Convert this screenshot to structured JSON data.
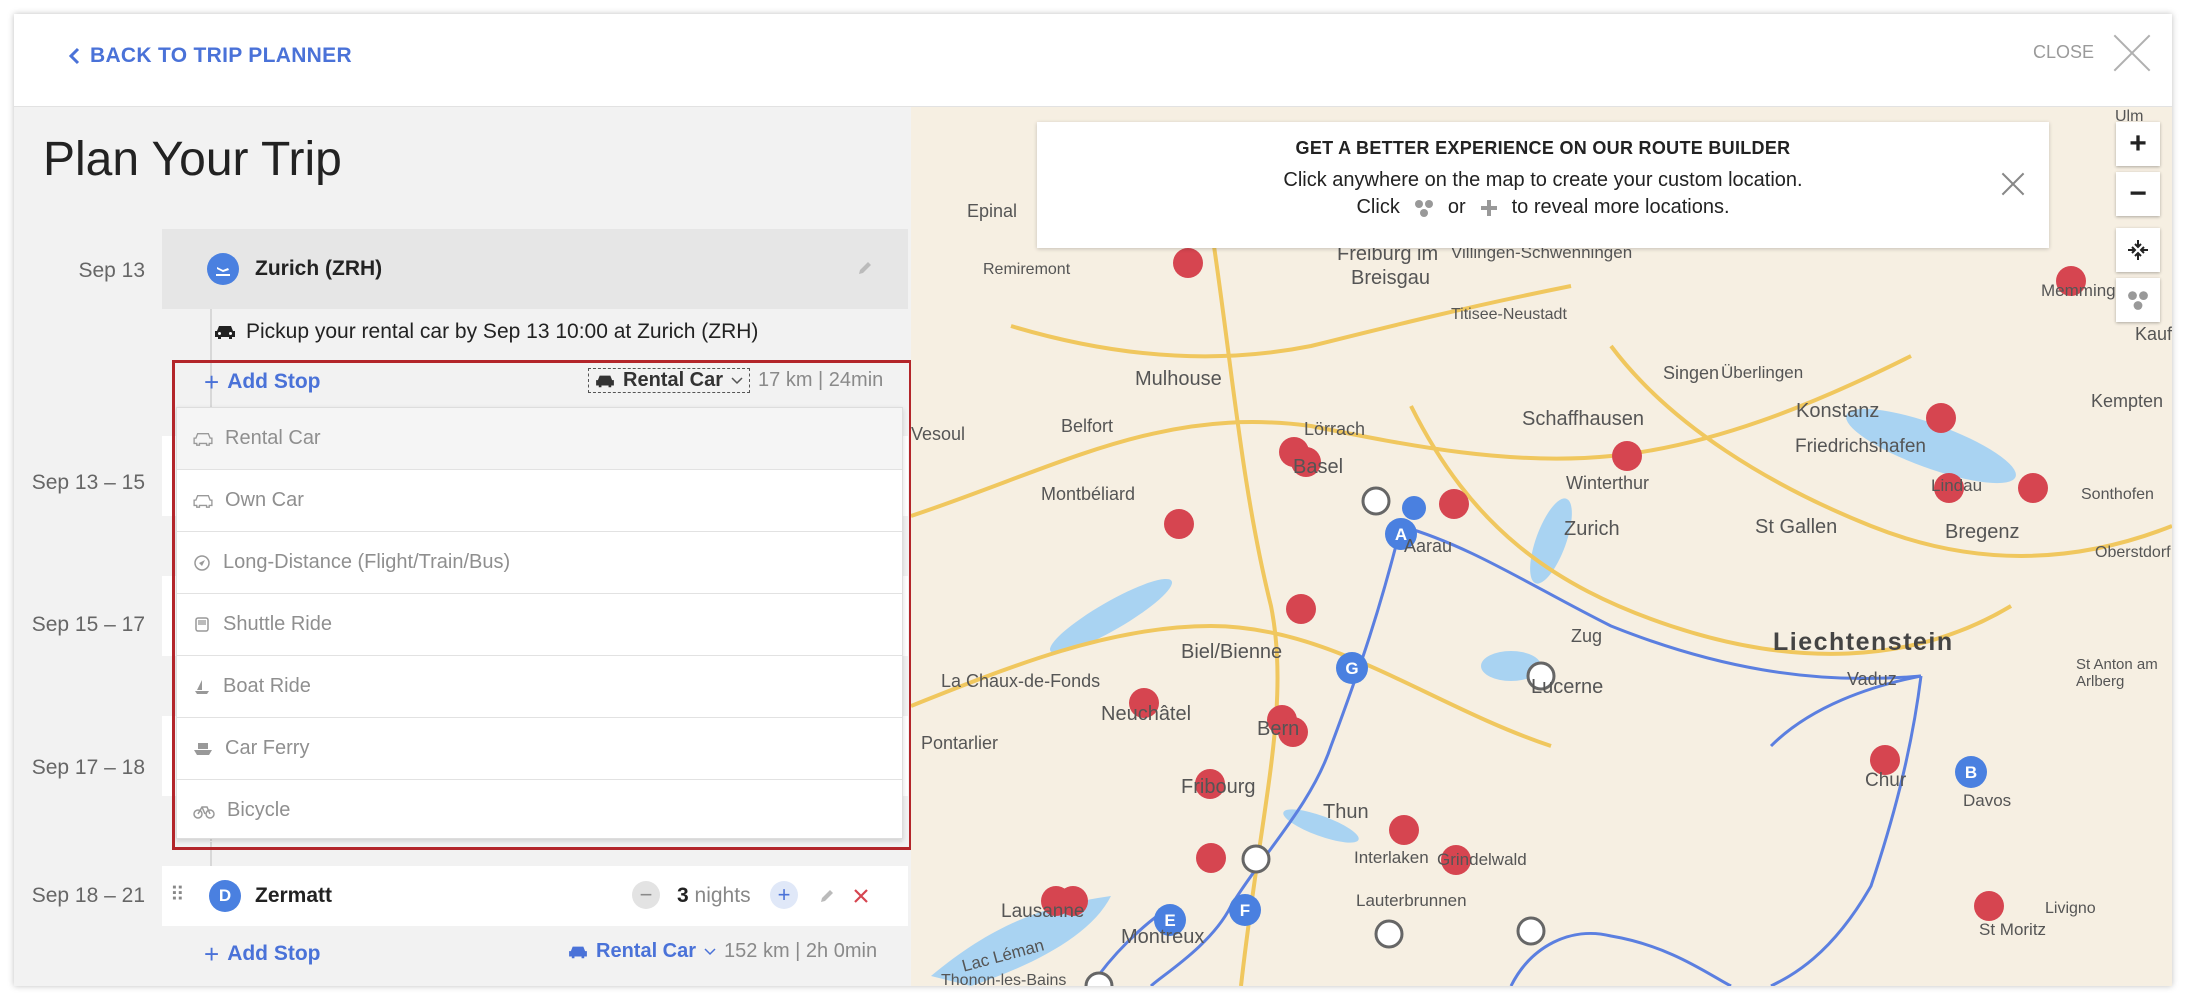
{
  "header": {
    "back_label": "BACK TO TRIP PLANNER",
    "close_label": "CLOSE"
  },
  "plan": {
    "title": "Plan Your Trip",
    "dates": [
      "Sep 13",
      "Sep 13 – 15",
      "Sep 15 – 17",
      "Sep 17 – 18",
      "Sep 18 – 21"
    ],
    "start": {
      "name": "Zurich (ZRH)"
    },
    "pickup_text": "Pickup your rental car by Sep 13 10:00 at Zurich (ZRH)",
    "leg1": {
      "add_stop": "Add Stop",
      "mode": "Rental Car",
      "distance": "17 km | 24min"
    },
    "dropdown_options": [
      "Rental Car",
      "Own Car",
      "Long-Distance (Flight/Train/Bus)",
      "Shuttle Ride",
      "Boat Ride",
      "Car Ferry",
      "Bicycle"
    ],
    "zermatt": {
      "badge": "D",
      "name": "Zermatt",
      "nights_value": "3",
      "nights_label": "nights"
    },
    "leg2": {
      "add_stop": "Add Stop",
      "mode": "Rental Car",
      "distance": "152 km | 2h 0min"
    }
  },
  "map": {
    "banner": {
      "title": "GET A BETTER EXPERIENCE ON OUR ROUTE BUILDER",
      "line1": "Click anywhere on the map to create your custom location.",
      "click": "Click",
      "or": "or",
      "reveal": "to reveal more locations."
    },
    "zoom_in": "+",
    "zoom_out": "−",
    "labels": [
      {
        "text": "Epinal"
      },
      {
        "text": "Remiremont"
      },
      {
        "text": "Freiburg im"
      },
      {
        "text": "Breisgau"
      },
      {
        "text": "Villingen-Schwenningen"
      },
      {
        "text": "Titisee-Neustadt"
      },
      {
        "text": "Mulhouse"
      },
      {
        "text": "Belfort"
      },
      {
        "text": "Lörrach"
      },
      {
        "text": "Basel"
      },
      {
        "text": "Montbéliard"
      },
      {
        "text": "Singen"
      },
      {
        "text": "Überlingen"
      },
      {
        "text": "Schaffhausen"
      },
      {
        "text": "Konstanz"
      },
      {
        "text": "Friedrichshafen"
      },
      {
        "text": "Winterthur"
      },
      {
        "text": "Zurich"
      },
      {
        "text": "Aarau"
      },
      {
        "text": "St Gallen"
      },
      {
        "text": "Bregenz"
      },
      {
        "text": "Lindau"
      },
      {
        "text": "Liechtenstein"
      },
      {
        "text": "Vaduz"
      },
      {
        "text": "Zug"
      },
      {
        "text": "Lucerne"
      },
      {
        "text": "Biel/Bienne"
      },
      {
        "text": "La Chaux-de-Fonds"
      },
      {
        "text": "Neuchâtel"
      },
      {
        "text": "Pontarlier"
      },
      {
        "text": "Bern"
      },
      {
        "text": "Fribourg"
      },
      {
        "text": "Thun"
      },
      {
        "text": "Interlaken"
      },
      {
        "text": "Grindelwald"
      },
      {
        "text": "Lauterbrunnen"
      },
      {
        "text": "Chur"
      },
      {
        "text": "Davos"
      },
      {
        "text": "Lausanne"
      },
      {
        "text": "Montreux"
      },
      {
        "text": "Lac Léman"
      },
      {
        "text": "Thonon-les-Bains"
      },
      {
        "text": "St Moritz"
      },
      {
        "text": "Livigno"
      },
      {
        "text": "Memmingen"
      },
      {
        "text": "Kempten"
      },
      {
        "text": "Sonthofen"
      },
      {
        "text": "Oberstdorf"
      },
      {
        "text": "St Anton am Arlberg"
      },
      {
        "text": "Kauf"
      },
      {
        "text": "Ulm"
      },
      {
        "text": "Vesoul"
      }
    ],
    "markers": [
      "A",
      "B",
      "E",
      "F",
      "G"
    ]
  },
  "colors": {
    "accent": "#4a72d8",
    "highlight": "#b3252a",
    "pin": "#d64550",
    "route": "#5b7fe0"
  }
}
